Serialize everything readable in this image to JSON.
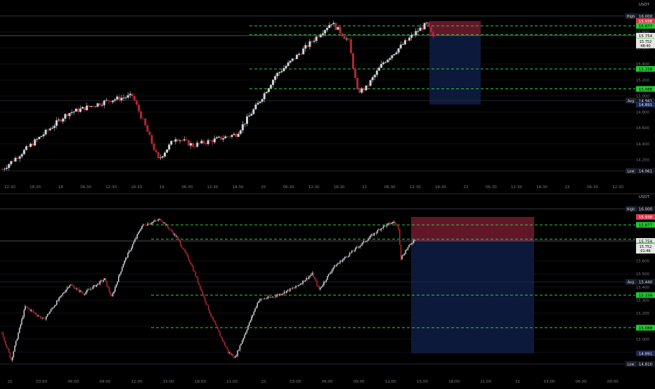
{
  "chart_data": [
    {
      "type": "candlestick",
      "id": "top",
      "currency": "USDT",
      "ylim": [
        13.95,
        16.06
      ],
      "y_ticks": [
        14.2,
        14.4,
        14.6,
        14.8,
        15.0,
        15.2,
        15.4,
        15.6,
        15.8
      ],
      "x_ticks": [
        "12:30",
        "18:30",
        "18",
        "06:30",
        "12:30",
        "18:30",
        "19",
        "06:30",
        "12:30",
        "18:30",
        "20",
        "06:30",
        "12:30",
        "18:30",
        "21",
        "06:30",
        "12:30",
        "18:30",
        "22",
        "06:30",
        "12:30",
        "18:30",
        "23",
        "06:30",
        "12:30"
      ],
      "levels": [
        15.877,
        15.767,
        15.338,
        15.088
      ],
      "price_labels": {
        "high": 16.0,
        "stop": 15.938,
        "level1": 15.877,
        "last": 15.754,
        "prev": 15.752,
        "timer": "48:40",
        "level2": 15.767,
        "level3": 15.338,
        "level4": 15.088,
        "avg": 14.941,
        "target": 14.891,
        "low": 14.061
      },
      "labels": {
        "high": "High",
        "avg": "Avg",
        "low": "Low"
      },
      "position": {
        "entry": 15.754,
        "stop": 15.938,
        "target": 14.891
      },
      "anchors": [
        [
          0,
          14.08
        ],
        [
          18,
          14.5
        ],
        [
          30,
          14.78
        ],
        [
          50,
          14.95
        ],
        [
          60,
          15.0
        ],
        [
          66,
          14.62
        ],
        [
          72,
          14.2
        ],
        [
          80,
          14.48
        ],
        [
          88,
          14.38
        ],
        [
          108,
          14.52
        ],
        [
          118,
          14.9
        ],
        [
          126,
          15.25
        ],
        [
          136,
          15.5
        ],
        [
          152,
          15.92
        ],
        [
          160,
          15.68
        ],
        [
          164,
          15.05
        ],
        [
          168,
          15.1
        ],
        [
          176,
          15.42
        ],
        [
          192,
          15.82
        ],
        [
          196,
          15.9
        ],
        [
          199,
          15.72
        ]
      ]
    },
    {
      "type": "candlestick",
      "id": "bottom",
      "currency": "USDT",
      "ylim": [
        14.79,
        16.04
      ],
      "y_ticks": [
        14.9,
        15.0,
        15.1,
        15.2,
        15.3,
        15.4,
        15.5,
        15.6
      ],
      "x_ticks": [
        "20",
        "03:00",
        "06:00",
        "09:00",
        "12:00",
        "15:00",
        "18:00",
        "21:00",
        "21",
        "03:00",
        "06:00",
        "09:00",
        "12:00",
        "15:00",
        "18:00",
        "21:00",
        "22",
        "03:00",
        "06:00",
        "09:00"
      ],
      "levels": [
        15.877,
        15.767,
        15.338,
        15.088
      ],
      "price_labels": {
        "high": 16.0,
        "stop": 15.938,
        "level1": 15.877,
        "last": 15.754,
        "prev": 15.752,
        "timer": "01:46",
        "level2": 15.767,
        "avg": 15.44,
        "level3": 15.338,
        "level4": 15.088,
        "target": 14.891,
        "low": 14.81
      },
      "labels": {
        "high": "High",
        "avg": "Avg",
        "low": "Low"
      },
      "position": {
        "entry": 15.754,
        "stop": 15.938,
        "target": 14.891
      },
      "anchors": [
        [
          0,
          15.05
        ],
        [
          8,
          14.84
        ],
        [
          20,
          15.25
        ],
        [
          36,
          15.15
        ],
        [
          58,
          15.42
        ],
        [
          70,
          15.35
        ],
        [
          88,
          15.46
        ],
        [
          94,
          15.32
        ],
        [
          104,
          15.58
        ],
        [
          120,
          15.87
        ],
        [
          136,
          15.92
        ],
        [
          150,
          15.78
        ],
        [
          162,
          15.58
        ],
        [
          180,
          15.16
        ],
        [
          194,
          14.9
        ],
        [
          200,
          14.86
        ],
        [
          220,
          15.3
        ],
        [
          234,
          15.33
        ],
        [
          252,
          15.4
        ],
        [
          266,
          15.5
        ],
        [
          272,
          15.38
        ],
        [
          284,
          15.55
        ],
        [
          300,
          15.67
        ],
        [
          326,
          15.86
        ],
        [
          336,
          15.9
        ],
        [
          340,
          15.85
        ],
        [
          342,
          15.62
        ],
        [
          346,
          15.68
        ],
        [
          354,
          15.77
        ]
      ]
    }
  ]
}
